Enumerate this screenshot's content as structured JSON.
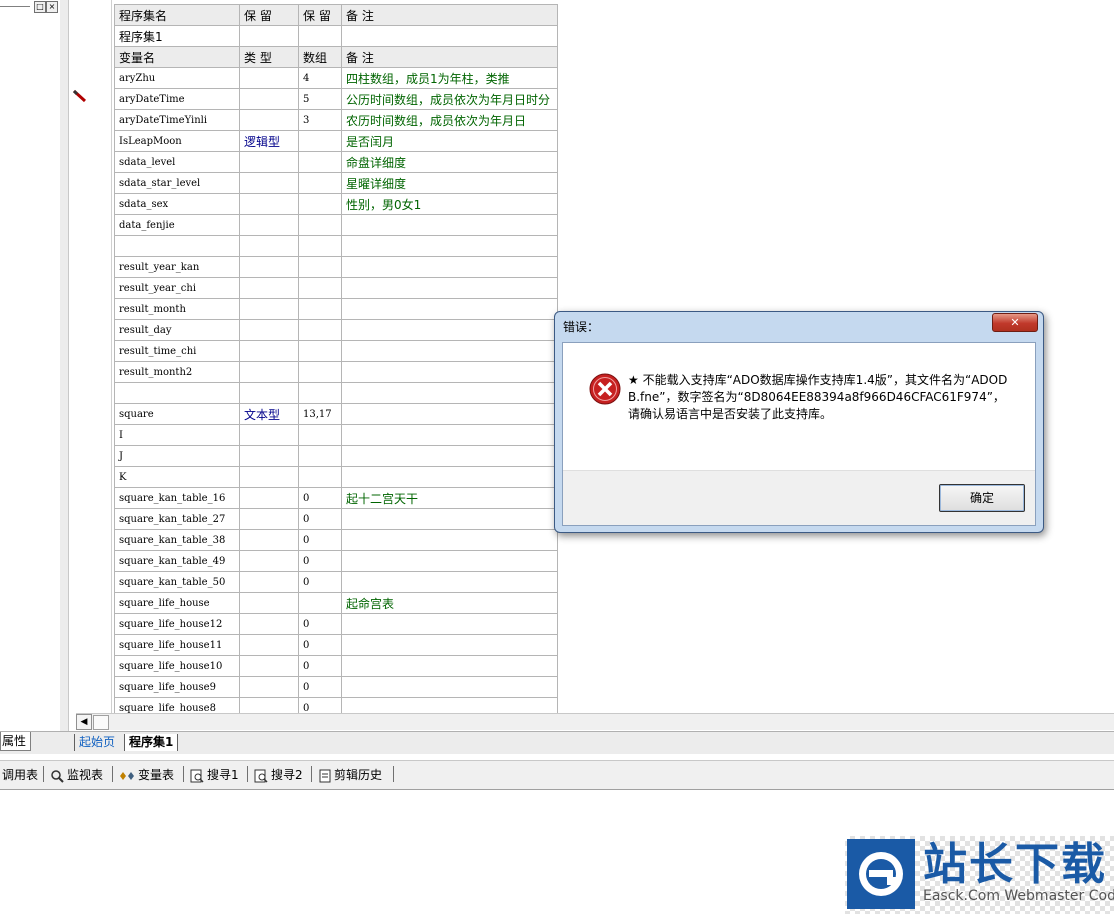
{
  "window": {
    "left_panel_buttons": [
      "□",
      "×"
    ]
  },
  "table": {
    "header_top": [
      "程序集名",
      "保 留",
      "保 留",
      "备 注"
    ],
    "assembly_row": [
      "程序集1",
      "",
      "",
      ""
    ],
    "header_vars": [
      "变量名",
      "类 型",
      "数组",
      "备 注"
    ],
    "rows": [
      {
        "name": "aryZhu",
        "type": "",
        "array": "4",
        "note": "四柱数组，成员1为年柱，类推"
      },
      {
        "name": "aryDateTime",
        "type": "",
        "array": "5",
        "note": "公历时间数组，成员依次为年月日时分"
      },
      {
        "name": "aryDateTimeYinli",
        "type": "",
        "array": "3",
        "note": "农历时间数组，成员依次为年月日"
      },
      {
        "name": "IsLeapMoon",
        "type": "逻辑型",
        "array": "",
        "note": "是否闰月"
      },
      {
        "name": "sdata_level",
        "type": "",
        "array": "",
        "note": "命盘详细度"
      },
      {
        "name": "sdata_star_level",
        "type": "",
        "array": "",
        "note": "星曜详细度"
      },
      {
        "name": "sdata_sex",
        "type": "",
        "array": "",
        "note": "性别，男0女1"
      },
      {
        "name": "data_fenjie",
        "type": "",
        "array": "",
        "note": ""
      },
      {
        "name": "",
        "type": "",
        "array": "",
        "note": ""
      },
      {
        "name": "result_year_kan",
        "type": "",
        "array": "",
        "note": ""
      },
      {
        "name": "result_year_chi",
        "type": "",
        "array": "",
        "note": ""
      },
      {
        "name": "result_month",
        "type": "",
        "array": "",
        "note": ""
      },
      {
        "name": "result_day",
        "type": "",
        "array": "",
        "note": ""
      },
      {
        "name": "result_time_chi",
        "type": "",
        "array": "",
        "note": ""
      },
      {
        "name": "result_month2",
        "type": "",
        "array": "",
        "note": ""
      },
      {
        "name": "",
        "type": "",
        "array": "",
        "note": ""
      },
      {
        "name": "square",
        "type": "文本型",
        "array": "13,17",
        "note": ""
      },
      {
        "name": "I",
        "type": "",
        "array": "",
        "note": ""
      },
      {
        "name": "J",
        "type": "",
        "array": "",
        "note": ""
      },
      {
        "name": "K",
        "type": "",
        "array": "",
        "note": ""
      },
      {
        "name": "square_kan_table_16",
        "type": "",
        "array": "0",
        "note": "起十二宫天干"
      },
      {
        "name": "square_kan_table_27",
        "type": "",
        "array": "0",
        "note": ""
      },
      {
        "name": "square_kan_table_38",
        "type": "",
        "array": "0",
        "note": ""
      },
      {
        "name": "square_kan_table_49",
        "type": "",
        "array": "0",
        "note": ""
      },
      {
        "name": "square_kan_table_50",
        "type": "",
        "array": "0",
        "note": ""
      },
      {
        "name": "square_life_house",
        "type": "",
        "array": "",
        "note": "起命宫表"
      },
      {
        "name": "square_life_house12",
        "type": "",
        "array": "0",
        "note": ""
      },
      {
        "name": "square_life_house11",
        "type": "",
        "array": "0",
        "note": ""
      },
      {
        "name": "square_life_house10",
        "type": "",
        "array": "0",
        "note": ""
      },
      {
        "name": "square_life_house9",
        "type": "",
        "array": "0",
        "note": ""
      },
      {
        "name": "square_life_house8",
        "type": "",
        "array": "0",
        "note": ""
      }
    ]
  },
  "tabs": {
    "attr": "属性",
    "start": "起始页",
    "assembly": "程序集1"
  },
  "bottom_bar": {
    "items": [
      "调用表",
      "监视表",
      "变量表",
      "搜寻1",
      "搜寻2",
      "剪辑历史"
    ]
  },
  "dialog": {
    "title": "错误：",
    "close": "✕",
    "message": "★ 不能载入支持库“ADO数据库操作支持库1.4版”，其文件名为“ADODB.fne”，数字签名为“8D8064EE88394a8f966D46CFAC61F974”，请确认易语言中是否安装了此支持库。",
    "ok": "确定"
  },
  "watermark": {
    "title": "站长下载",
    "subtitle": "Easck.Com Webmaster Codes"
  },
  "colors": {
    "type_text": "#00008b",
    "note_text": "#006400",
    "dialog_frame": "#c5d9ef",
    "watermark": "#1a5aa6"
  }
}
